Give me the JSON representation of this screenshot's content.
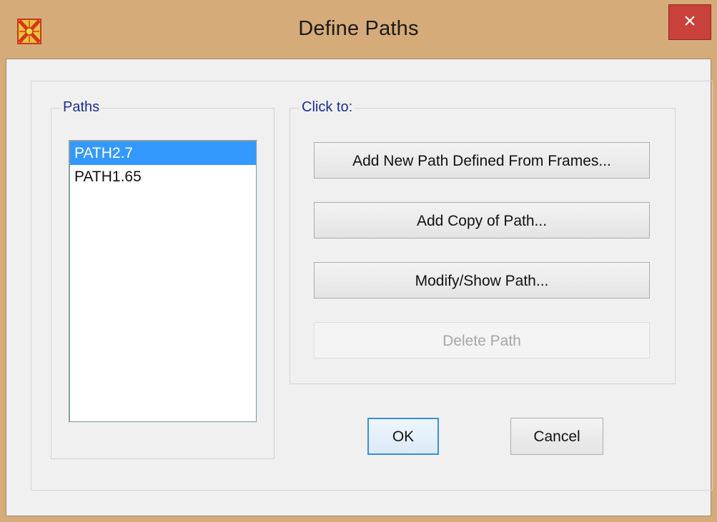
{
  "window": {
    "title": "Define Paths",
    "app_icon": "sap2000-app-icon",
    "close_label": "×"
  },
  "paths_group": {
    "legend": "Paths",
    "items": [
      {
        "label": "PATH2.7",
        "selected": true
      },
      {
        "label": "PATH1.65",
        "selected": false
      }
    ]
  },
  "click_group": {
    "legend": "Click to:",
    "add_new_label": "Add New Path Defined From Frames...",
    "add_copy_label": "Add Copy of Path...",
    "modify_label": "Modify/Show Path...",
    "delete_label": "Delete Path",
    "delete_enabled": false
  },
  "footer": {
    "ok_label": "OK",
    "cancel_label": "Cancel"
  },
  "colors": {
    "frame": "#d6ab7a",
    "close_button": "#c9413a",
    "selection": "#3399ff",
    "legend_text": "#1b2d8c"
  }
}
